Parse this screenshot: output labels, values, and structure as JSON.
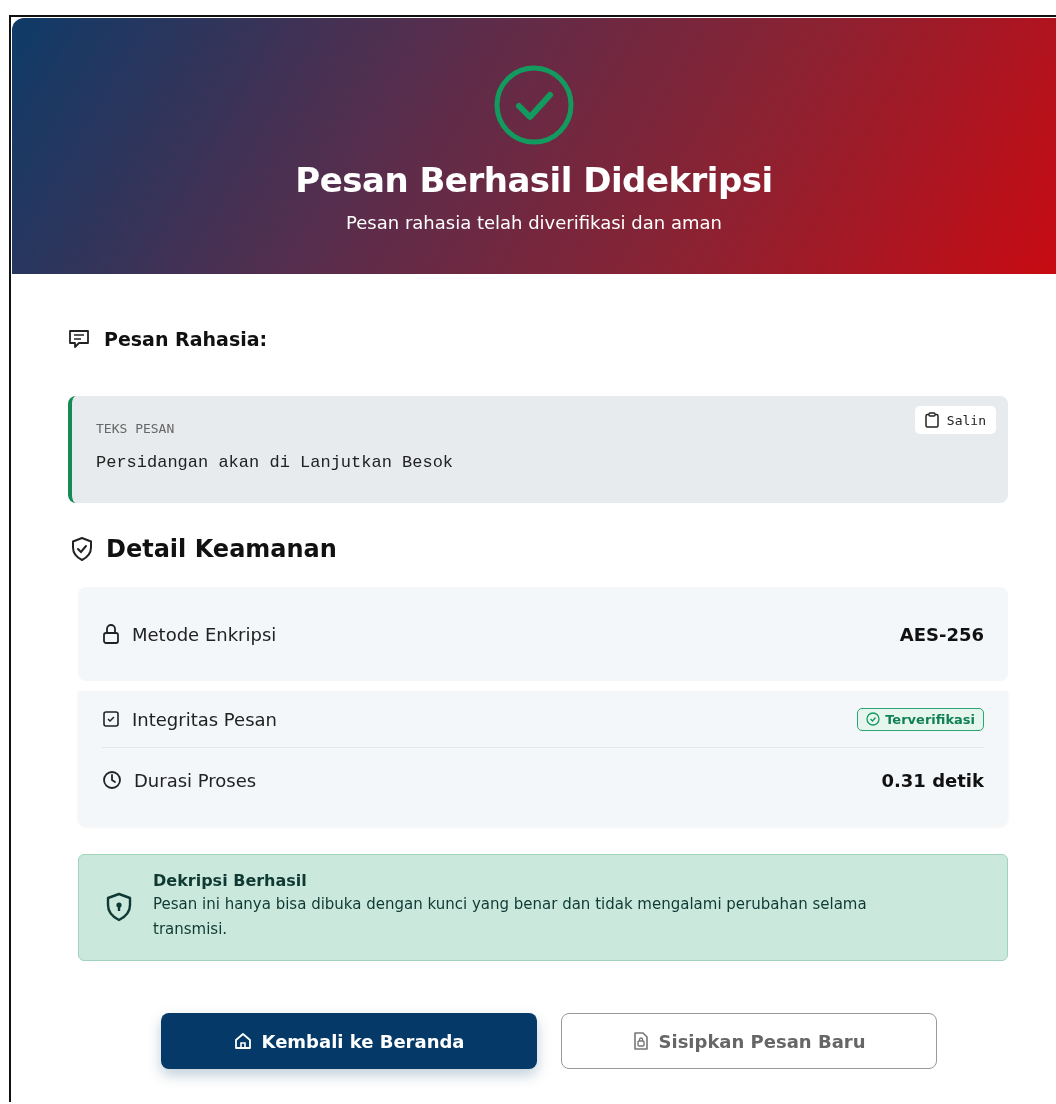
{
  "header": {
    "title": "Pesan Berhasil Didekripsi",
    "subtitle": "Pesan rahasia telah diverifikasi dan aman"
  },
  "message": {
    "heading": "Pesan Rahasia:",
    "label": "TEKS PESAN",
    "text": "Persidangan akan di Lanjutkan Besok",
    "copy_button": "Salin"
  },
  "security": {
    "heading": "Detail Keamanan",
    "rows": [
      {
        "label": "Metode Enkripsi",
        "value": "AES-256",
        "kind": "text"
      },
      {
        "label": "Integritas Pesan",
        "value": "Terverifikasi",
        "kind": "badge"
      },
      {
        "label": "Durasi Proses",
        "value": "0.31 detik",
        "kind": "text"
      }
    ]
  },
  "alert": {
    "title": "Dekripsi Berhasil",
    "text": "Pesan ini hanya bisa dibuka dengan kunci yang benar dan tidak mengalami perubahan selama transmisi."
  },
  "buttons": [
    {
      "label": "Kembali ke Beranda",
      "kind": "primary"
    },
    {
      "label": "Sisipkan Pesan Baru",
      "kind": "secondary"
    }
  ]
}
